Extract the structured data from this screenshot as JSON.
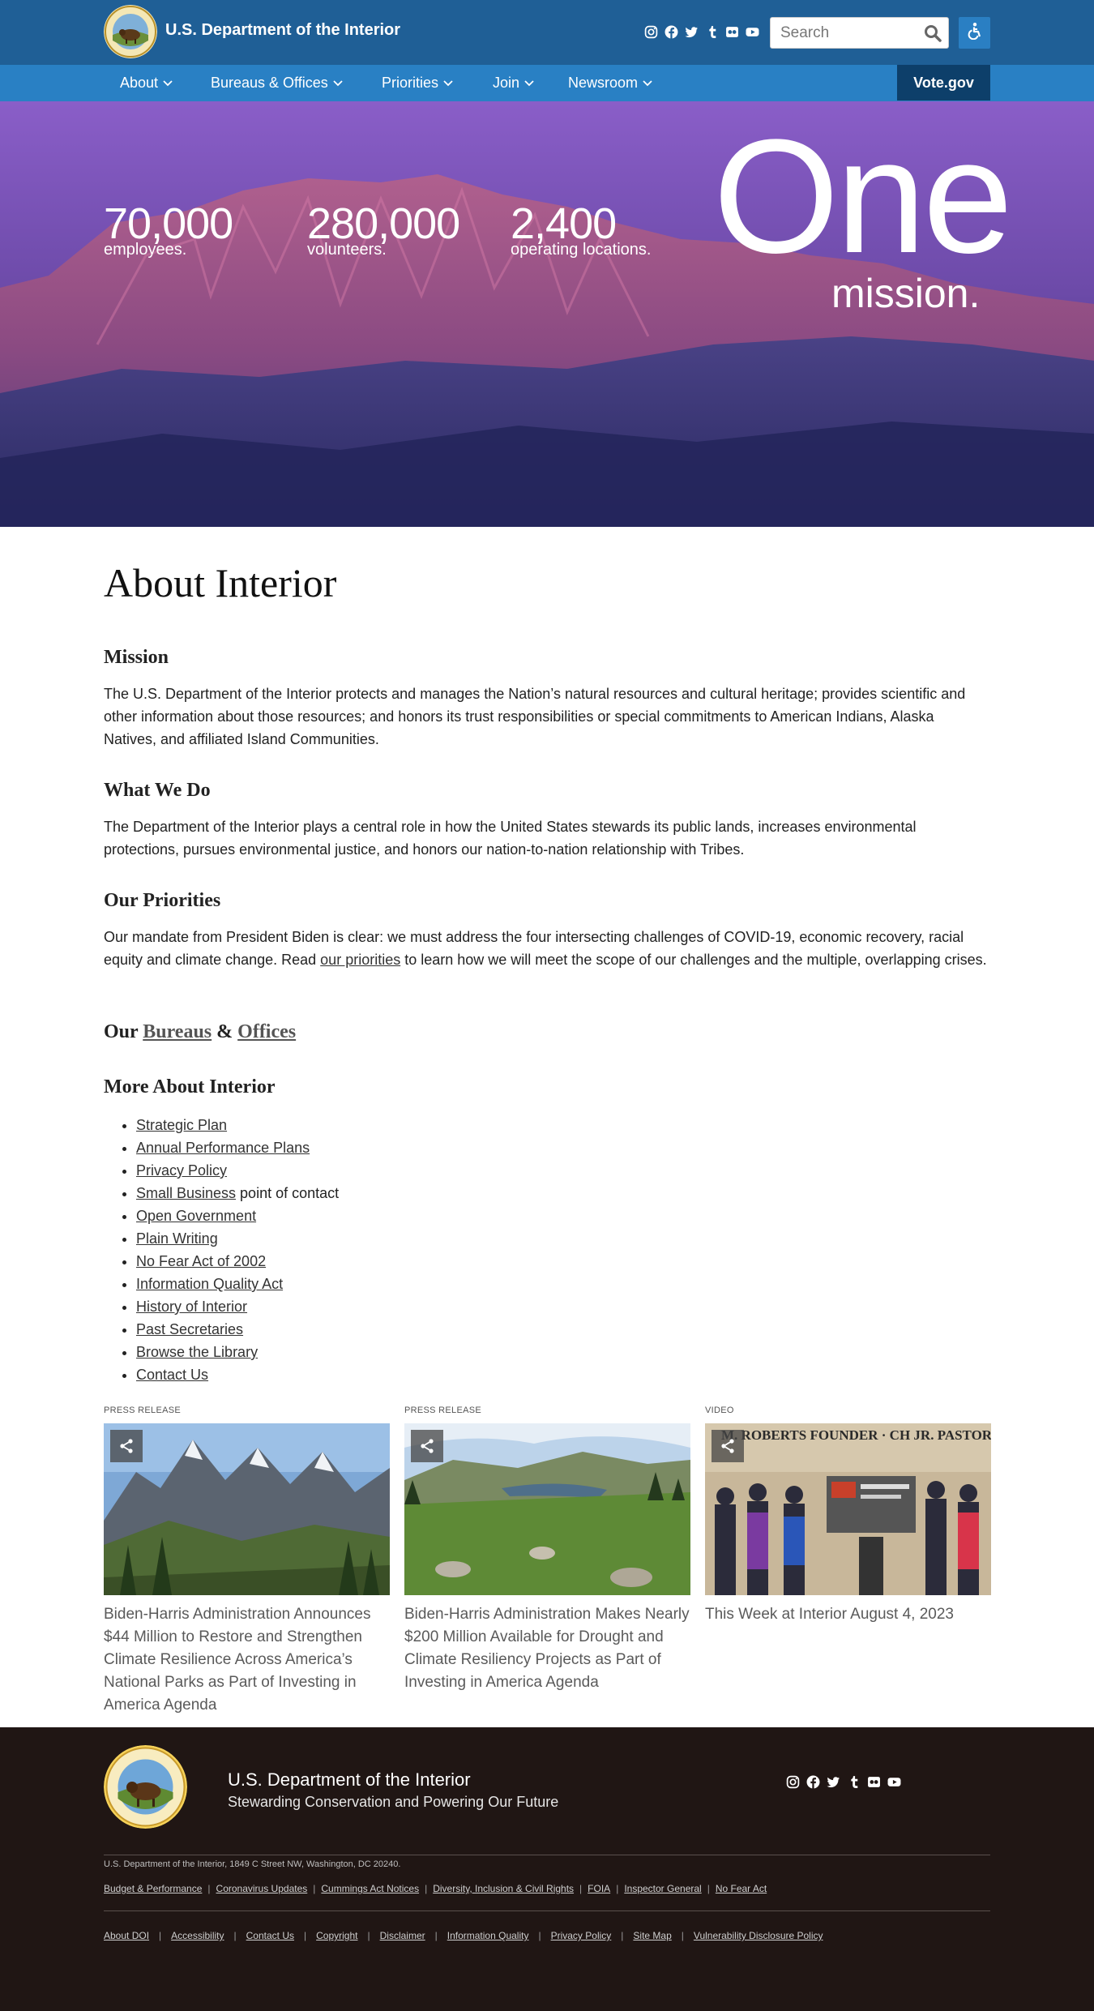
{
  "header": {
    "site_title": "U.S. Department of the Interior",
    "social_icons": [
      "instagram-icon",
      "facebook-icon",
      "twitter-icon",
      "tumblr-icon",
      "flickr-icon",
      "youtube-icon"
    ],
    "search_placeholder": "Search",
    "accessibility_icon": "accessibility-icon"
  },
  "nav": {
    "items": [
      {
        "label": "About"
      },
      {
        "label": "Bureaus & Offices"
      },
      {
        "label": "Priorities"
      },
      {
        "label": "Join"
      },
      {
        "label": "Newsroom"
      }
    ],
    "cta_label": "Vote.gov"
  },
  "hero": {
    "stats": [
      {
        "value": "70,000",
        "label": "employees."
      },
      {
        "value": "280,000",
        "label": "volunteers."
      },
      {
        "value": "2,400",
        "label": "operating locations."
      }
    ],
    "headline_big": "One",
    "headline_small": "mission."
  },
  "main": {
    "title": "About Interior",
    "mission": {
      "heading": "Mission",
      "text": "The U.S. Department of the Interior protects and manages the Nation’s natural resources and cultural heritage; provides scientific and other information about those resources; and honors its trust responsibilities or special commitments to American Indians, Alaska Natives, and affiliated Island Communities."
    },
    "what_we_do": {
      "heading": "What We Do",
      "text": "The Department of the Interior plays a central role in how the United States stewards its public lands, increases environmental protections, pursues environmental justice, and honors our nation-to-nation relationship with Tribes."
    },
    "priorities": {
      "heading": "Our Priorities",
      "text_before": "Our mandate from President Biden is clear: we must address the four intersecting challenges of COVID-19, economic recovery, racial equity and climate change. Read ",
      "link": "our priorities",
      "text_after": " to learn how we will meet the scope of our challenges and the multiple, overlapping crises."
    },
    "bureaus": {
      "prefix": "Our ",
      "link1": "Bureaus",
      "amp": " & ",
      "link2": "Offices"
    },
    "more": {
      "heading": "More About Interior",
      "items": [
        {
          "link": "Strategic Plan",
          "suffix": ""
        },
        {
          "link": "Annual Performance Plans",
          "suffix": ""
        },
        {
          "link": "Privacy Policy",
          "suffix": ""
        },
        {
          "link": "Small Business",
          "suffix": " point of contact"
        },
        {
          "link": "Open Government",
          "suffix": ""
        },
        {
          "link": "Plain Writing ",
          "suffix": ""
        },
        {
          "link": "No Fear Act of 2002",
          "suffix": ""
        },
        {
          "link": "Information Quality Act",
          "suffix": ""
        },
        {
          "link": "History of Interior",
          "suffix": ""
        },
        {
          "link": "Past Secretaries",
          "suffix": ""
        },
        {
          "link": "Browse the Library",
          "suffix": ""
        },
        {
          "link": "Contact Us",
          "suffix": ""
        }
      ]
    }
  },
  "cards": [
    {
      "kind": "Press Release",
      "title": "Biden-Harris Administration Announces $44 Million to Restore and Strengthen Climate Resilience Across America’s National Parks as Part of Investing in America Agenda"
    },
    {
      "kind": "Press Release",
      "title": "Biden-Harris Administration Makes Nearly $200 Million Available for Drought and Climate Resiliency Projects as Part of Investing in America Agenda"
    },
    {
      "kind": "Video",
      "title": "This Week at Interior August 4, 2023",
      "image_sign": "M. ROBERTS FOUNDER · CH JR. PASTOR"
    }
  ],
  "footer": {
    "title": "U.S. Department of the Interior",
    "subtitle": "Stewarding Conservation and Powering Our Future",
    "links_row1": [
      "Budget & Performance",
      "Coronavirus Updates",
      "Cummings Act Notices",
      "Diversity, Inclusion & Civil Rights",
      "FOIA",
      "Inspector General",
      "No Fear Act"
    ],
    "links_row2": [
      "About DOI",
      "Accessibility",
      "Contact Us",
      "Copyright",
      "Disclaimer",
      "Information Quality",
      "Privacy Policy",
      "Site Map",
      "Vulnerability Disclosure Policy"
    ],
    "address": "U.S. Department of the Interior, 1849 C Street NW, Washington, DC 20240.",
    "seal_text": "U.S. DEPARTMENT OF THE INTERIOR · MARCH 3, 1849"
  },
  "colors": {
    "topbar": "#1f5f96",
    "nav": "#2980c4",
    "cta": "#0d3f6a",
    "footer": "#201614"
  }
}
